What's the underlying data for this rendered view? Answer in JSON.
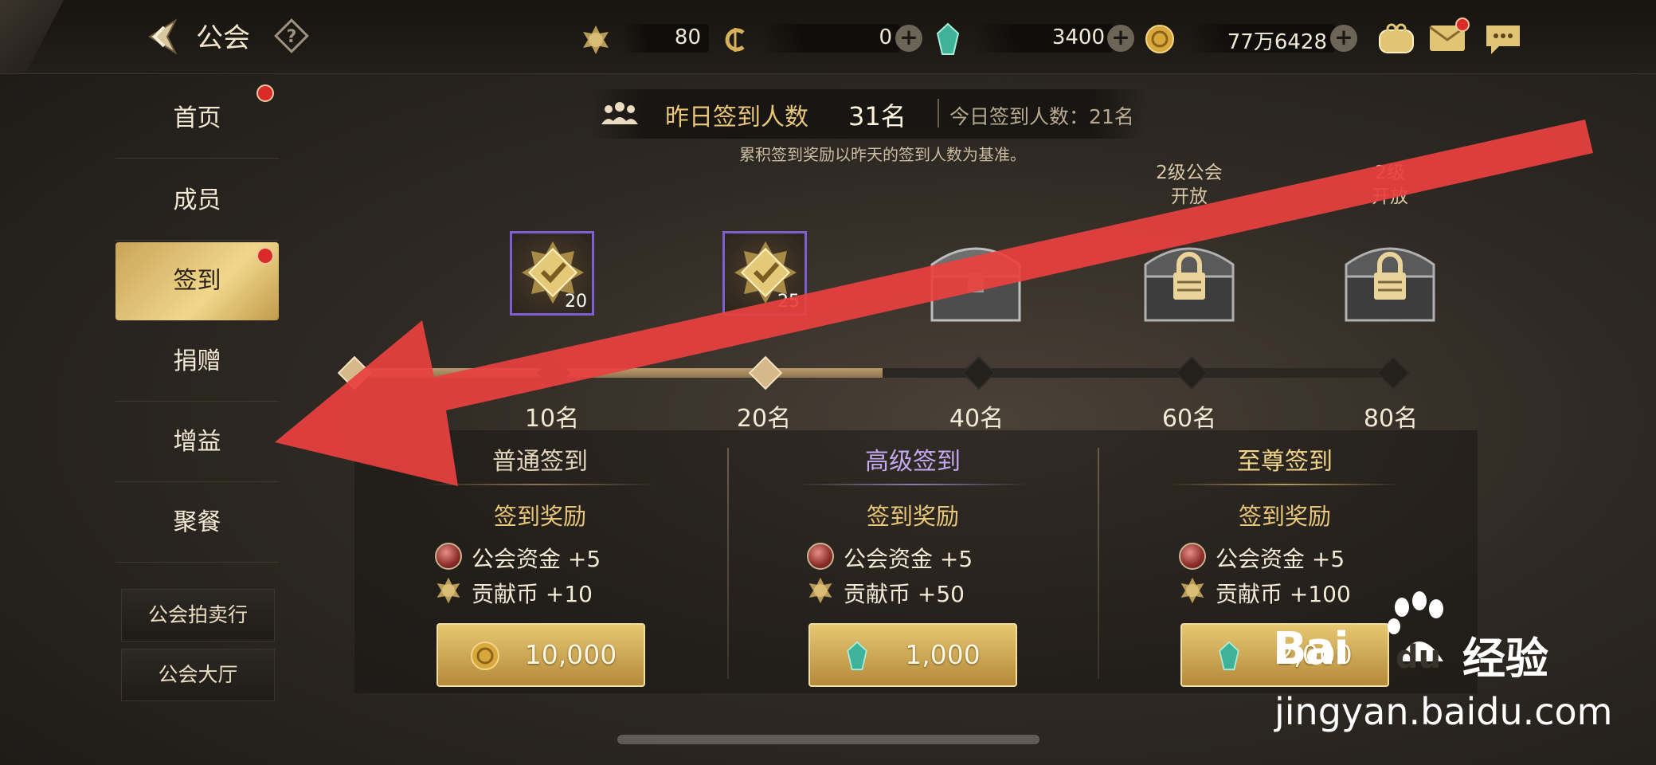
{
  "header": {
    "title": "公会",
    "currencies": [
      {
        "icon": "contribution-coin-icon",
        "value": "80",
        "plus": false
      },
      {
        "icon": "c-coin-icon",
        "value": "0",
        "plus": true
      },
      {
        "icon": "crystal-icon",
        "value": "3400",
        "plus": true
      },
      {
        "icon": "gold-coin-icon",
        "value": "77万6428",
        "plus": true
      }
    ]
  },
  "sidebar": {
    "items": [
      {
        "label": "首页",
        "dot": true
      },
      {
        "label": "成员",
        "dot": false
      },
      {
        "label": "签到",
        "dot": true,
        "active": true
      },
      {
        "label": "捐赠",
        "dot": false
      },
      {
        "label": "增益",
        "dot": false
      },
      {
        "label": "聚餐",
        "dot": false
      }
    ],
    "buttons": [
      "公会拍卖行",
      "公会大厅"
    ]
  },
  "signin": {
    "yesterday_label": "昨日签到人数",
    "yesterday_count": "31名",
    "today_text": "今日签到人数：21名",
    "note": "累积签到奖励以昨天的签到人数为基准。",
    "milestones": [
      {
        "label": "10名",
        "reward_count": "20",
        "state": "claimed-badge"
      },
      {
        "label": "20名",
        "reward_count": "25",
        "state": "claimed-badge"
      },
      {
        "label": "40名",
        "state": "chest"
      },
      {
        "label": "60名",
        "state": "locked-chest",
        "note": "2级公会\n开放"
      },
      {
        "label": "80名",
        "state": "locked-chest",
        "note": "2级\n开放"
      }
    ],
    "progress_fraction": 0.51
  },
  "tiers": [
    {
      "title": "普通签到",
      "title_color": "#e2d6bc",
      "reward_label": "签到奖励",
      "rewards": [
        {
          "icon": "guild-fund-icon",
          "text": "公会资金 +5"
        },
        {
          "icon": "contribution-coin-icon",
          "text": "贡献币 +10"
        }
      ],
      "cost_icon": "gold-coin-icon",
      "cost": "10,000"
    },
    {
      "title": "高级签到",
      "title_color": "#c4a9f0",
      "reward_label": "签到奖励",
      "rewards": [
        {
          "icon": "guild-fund-icon",
          "text": "公会资金 +5"
        },
        {
          "icon": "contribution-coin-icon",
          "text": "贡献币 +50"
        }
      ],
      "cost_icon": "crystal-icon",
      "cost": "1,000"
    },
    {
      "title": "至尊签到",
      "title_color": "#f0d48a",
      "reward_label": "签到奖励",
      "rewards": [
        {
          "icon": "guild-fund-icon",
          "text": "公会资金 +5"
        },
        {
          "icon": "contribution-coin-icon",
          "text": "贡献币 +100"
        }
      ],
      "cost_icon": "crystal-icon",
      "cost": "2,000"
    }
  ],
  "watermark": {
    "brand": "Bai",
    "brand2": "du",
    "cn": "经验",
    "url": "jingyan.baidu.com"
  },
  "colors": {
    "accent_gold": "#e8c77b",
    "arrow_red": "#e8413f",
    "active_tab": "#e3c06c"
  }
}
